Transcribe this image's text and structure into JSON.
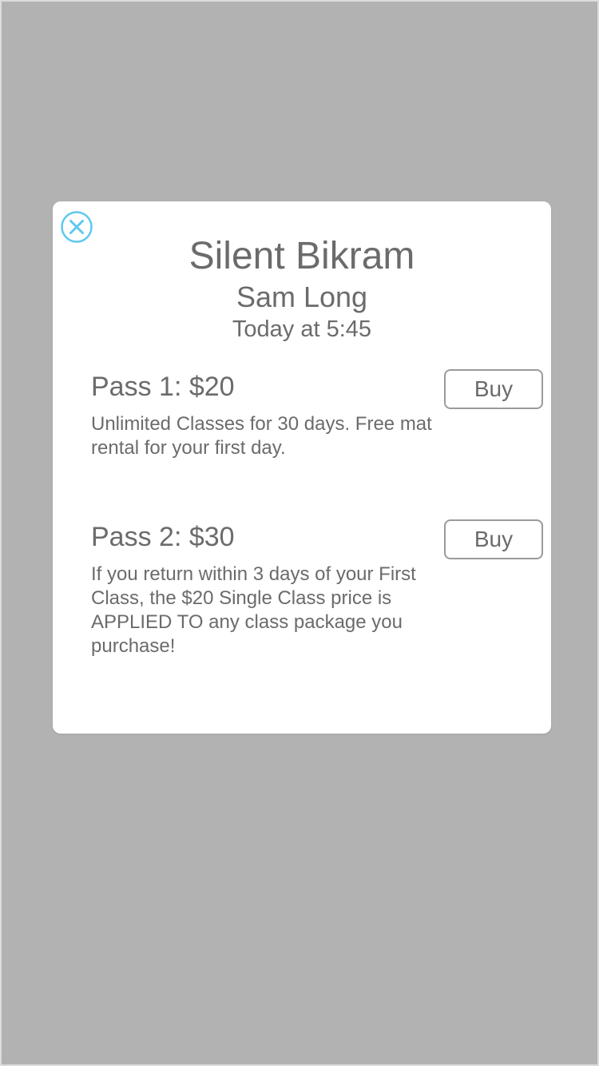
{
  "modal": {
    "title": "Silent Bikram",
    "instructor": "Sam Long",
    "time": "Today at 5:45",
    "close_icon": "close-circle-icon",
    "accent_color": "#5ec8ef"
  },
  "passes": [
    {
      "name": "Pass 1: $20",
      "description": "Unlimited Classes for 30 days. Free mat rental for your first day.",
      "buy_label": "Buy"
    },
    {
      "name": "Pass 2: $30",
      "description": "If you return within 3 days of your First Class, the $20 Single Class price is APPLIED TO any class package you purchase!",
      "buy_label": "Buy"
    }
  ]
}
